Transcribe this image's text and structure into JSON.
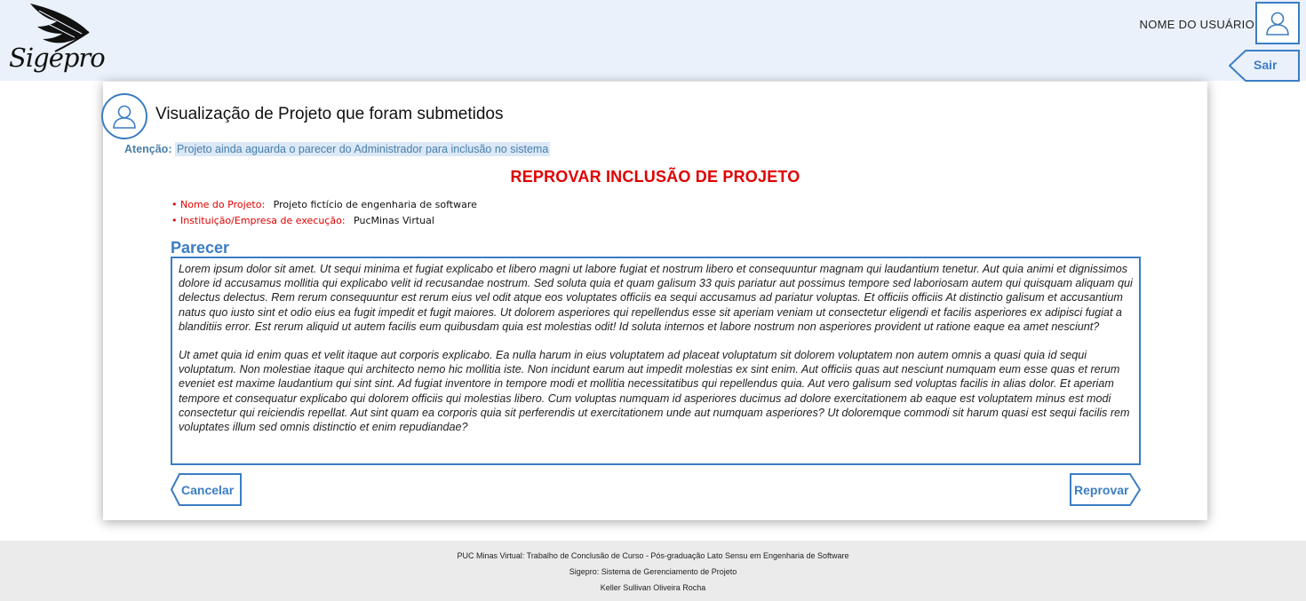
{
  "header": {
    "logo_text": "Sigepro",
    "username": "NOME DO USUÁRIO",
    "logout_label": "Sair"
  },
  "page": {
    "title": "Visualização de Projeto que foram submetidos",
    "attention_label": "Atenção:",
    "attention_message": "Projeto ainda aguarda o parecer do Administrador para inclusão no sistema",
    "action_title": "REPROVAR INCLUSÃO DE PROJETO"
  },
  "project": {
    "name_label": "• Nome do Projeto:",
    "name_value": "Projeto fictício de engenharia de software",
    "institution_label": "• Instituição/Empresa de execução:",
    "institution_value": "PucMinas Virtual"
  },
  "parecer": {
    "title": "Parecer",
    "paragraph1": "Lorem ipsum dolor sit amet. Ut sequi minima et fugiat explicabo et libero magni ut labore fugiat et nostrum libero et consequuntur magnam qui laudantium tenetur. Aut quia animi et dignissimos dolore id accusamus mollitia qui explicabo velit id recusandae nostrum. Sed soluta quia et quam galisum 33 quis pariatur aut possimus tempore sed laboriosam autem qui quisquam aliquam qui delectus delectus. Rem rerum consequuntur est rerum eius vel odit atque eos voluptates officiis ea sequi accusamus ad pariatur voluptas. Et officiis officiis At distinctio galisum et accusantium natus quo iusto sint et odio eius ea fugit impedit et fugit maiores. Ut dolorem asperiores qui repellendus esse sit aperiam veniam ut consectetur eligendi et facilis asperiores ex adipisci fugiat a blanditiis error. Est rerum aliquid ut autem facilis eum quibusdam quia est molestias odit! Id soluta internos et labore nostrum non asperiores provident ut ratione eaque ea amet nesciunt?",
    "paragraph2": "Ut amet quia id enim quas et velit itaque aut corporis explicabo. Ea nulla harum in eius voluptatem ad placeat voluptatum sit dolorem voluptatem non autem omnis a quasi quia id sequi voluptatum. Non molestiae itaque qui architecto nemo hic mollitia iste. Non incidunt earum aut impedit molestias ex sint enim. Aut officiis quas aut nesciunt numquam eum esse quas et rerum eveniet est maxime laudantium qui sint sint. Ad fugiat inventore in tempore modi et mollitia necessitatibus qui repellendus quia. Aut vero galisum sed voluptas facilis in alias dolor. Et aperiam tempore et consequatur explicabo qui dolorem officiis qui molestias libero. Cum voluptas numquam id asperiores ducimus ad dolore exercitationem ab eaque est voluptatem minus est modi consectetur qui reiciendis repellat. Aut sint quam ea corporis quia sit perferendis ut exercitationem unde aut numquam asperiores? Ut doloremque commodi sit harum quasi est sequi facilis rem voluptates illum sed omnis distinctio et enim repudiandae?"
  },
  "actions": {
    "cancel_label": "Cancelar",
    "reject_label": "Reprovar"
  },
  "footer": {
    "line1": "PUC Minas Virtual: Trabalho de Conclusão de Curso - Pós-graduação Lato Sensu em Engenharia de Software",
    "line2": "Sigepro: Sistema de Gerenciamento de Projeto",
    "line3": "Keller Sullivan Oliveira Rocha"
  },
  "colors": {
    "accent": "#3b7dc4",
    "danger": "#e00000",
    "header_bg": "#eaf1fb",
    "footer_bg": "#ebebeb"
  },
  "icons": [
    "feather-quill-icon",
    "user-icon",
    "chevron-left-button-shape",
    "chevron-right-button-shape"
  ]
}
